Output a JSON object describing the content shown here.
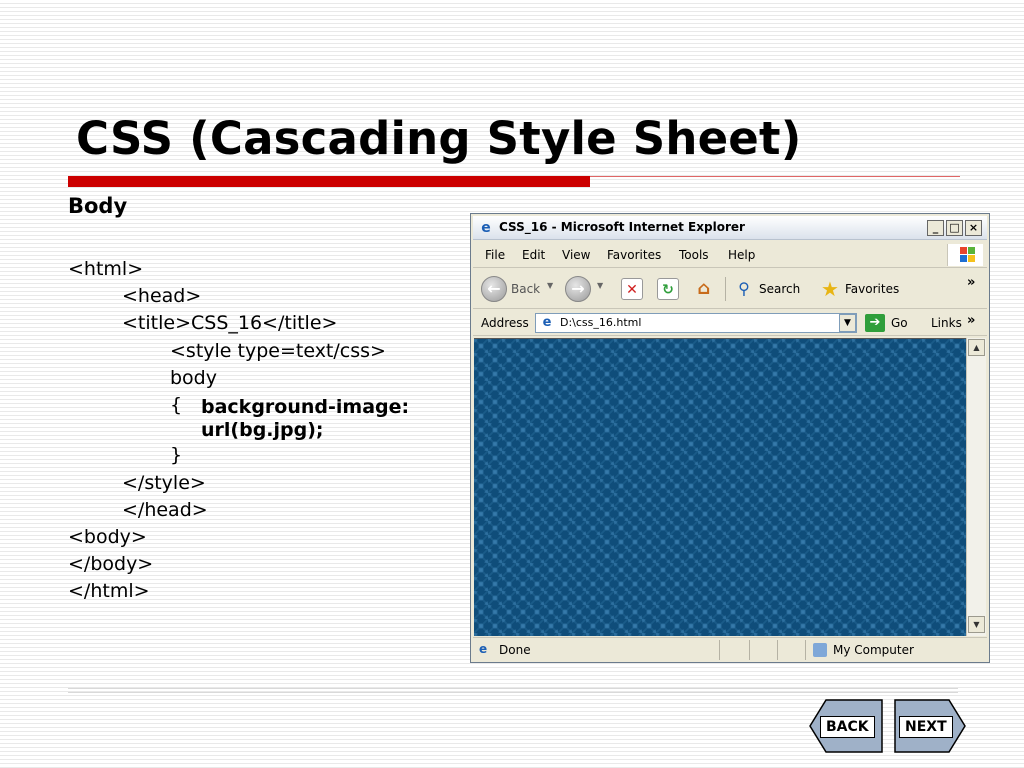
{
  "slide": {
    "title": "CSS (Cascading Style Sheet)",
    "section": "Body",
    "code": [
      "<html>",
      "<head>",
      "<title>CSS_16</title>",
      "<style type=text/css>",
      "body",
      "{",
      "background-image:",
      "url(bg.jpg);",
      "}",
      "</style>",
      "</head>",
      "<body>",
      "</body>",
      "</html>"
    ],
    "accent_color": "#cc0000"
  },
  "nav": {
    "back_label": "BACK",
    "next_label": "NEXT"
  },
  "browser": {
    "title": "CSS_16 - Microsoft Internet Explorer",
    "controls": {
      "minimize": "_",
      "maximize": "□",
      "close": "×"
    },
    "menu": [
      "File",
      "Edit",
      "View",
      "Favorites",
      "Tools",
      "Help"
    ],
    "toolbar": {
      "back": "Back",
      "search": "Search",
      "favorites": "Favorites"
    },
    "address_label": "Address",
    "address_value": "D:\\css_16.html",
    "go_label": "Go",
    "links_label": "Links",
    "status_text": "Done",
    "zone_text": "My Computer",
    "page_bg_color": "#0f4d7a"
  }
}
